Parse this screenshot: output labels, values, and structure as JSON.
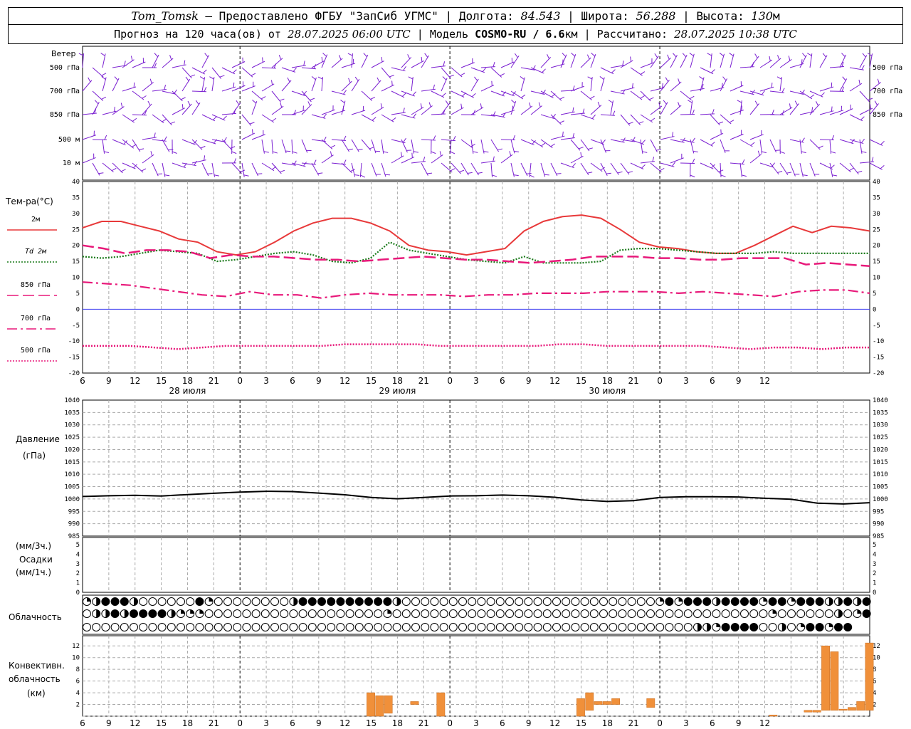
{
  "header": {
    "station": "Tom_Tomsk",
    "provider": " – Предоставлено ФГБУ \"ЗапСиб УГМС\" | Долгота: ",
    "lon": "84.543",
    "lat_label": " | Широта: ",
    "lat": "56.288",
    "alt_label": " | Высота: ",
    "alt": "130",
    "alt_unit": "м",
    "line2_a": "Прогноз на 120 часа(ов) от ",
    "run_time": "28.07.2025 06:00 UTC",
    "line2_b": " | Модель ",
    "model": "COSMO-RU / 6.6",
    "model_unit": "км",
    "line2_c": " | Рассчитано: ",
    "calc_time": "28.07.2025 10:38 UTC"
  },
  "panels": {
    "wind": {
      "title": "Ветер",
      "levels": [
        "500 гПа",
        "700 гПа",
        "850 гПа",
        "500 м",
        "10 м"
      ]
    },
    "temp": {
      "title": "Тем-ра(°С)",
      "legend": [
        {
          "label": "2м",
          "color": "#e8393a",
          "dash": "solid"
        },
        {
          "label": "Td 2м",
          "color": "#1a7a1a",
          "dash": "dotted"
        },
        {
          "label": "850 гПа",
          "color": "#e8197a",
          "dash": "long"
        },
        {
          "label": "700 гПа",
          "color": "#e8197a",
          "dash": "dashdot"
        },
        {
          "label": "500 гПа",
          "color": "#e8197a",
          "dash": "dotted"
        }
      ],
      "yticks": [
        40,
        35,
        30,
        25,
        20,
        15,
        10,
        5,
        0,
        -5,
        -10,
        -15,
        -20
      ]
    },
    "pressure": {
      "title": "Давление",
      "unit": "(гПа)",
      "yticks": [
        1040,
        1035,
        1030,
        1025,
        1020,
        1015,
        1010,
        1005,
        1000,
        995,
        990,
        985
      ]
    },
    "precip": {
      "unit_top": "(мм/3ч.)",
      "title": "Осадки",
      "unit_bottom": "(мм/1ч.)",
      "yticks": [
        5,
        4,
        3,
        2,
        1,
        0
      ]
    },
    "cloud": {
      "title": "Облачность"
    },
    "conv": {
      "title1": "Конвективн.",
      "title2": "облачность",
      "unit": "(км)",
      "yticks": [
        12,
        10,
        8,
        6,
        4,
        2
      ]
    }
  },
  "time_axis": {
    "ticks": [
      "6",
      "9",
      "12",
      "15",
      "18",
      "21",
      "0",
      "3",
      "6",
      "9",
      "12",
      "15",
      "18",
      "21",
      "0",
      "3",
      "6",
      "9",
      "12",
      "15",
      "18",
      "21",
      "0",
      "3",
      "6",
      "9",
      "12"
    ],
    "days": [
      "28 июля",
      "29 июля",
      "30 июля"
    ]
  },
  "colors": {
    "wind": "#7a1fd1",
    "t2m": "#e8393a",
    "td": "#1a7a1a",
    "upper": "#e8197a",
    "pressure": "#000000",
    "conv": "#f0903a",
    "zero": "#3a3af0"
  },
  "chart_data": {
    "type": "line",
    "x_hours": [
      0,
      3,
      6,
      9,
      12,
      15,
      18,
      21,
      24,
      27,
      30,
      33,
      36,
      39,
      42,
      45,
      48,
      51,
      54,
      57,
      60,
      63,
      66,
      69,
      72,
      75,
      78
    ],
    "series": [
      {
        "name": "2м",
        "values": [
          25.5,
          27.5,
          27.5,
          26,
          24.5,
          22,
          21,
          18,
          17,
          18,
          21,
          24.5,
          27,
          28.5,
          28.5,
          27,
          24.5,
          20,
          18.5,
          18,
          17,
          18,
          19,
          24.5,
          27.5,
          29,
          29.5,
          28.5,
          25,
          21,
          19.5,
          19,
          18,
          17.5,
          17.5,
          20,
          23,
          26,
          24,
          26,
          25.5,
          24.5
        ]
      },
      {
        "name": "Td 2м",
        "values": [
          16.5,
          16,
          16.5,
          17.5,
          18.5,
          18,
          17.5,
          15,
          15.5,
          16.5,
          17.5,
          18,
          17,
          15,
          14.5,
          16,
          21,
          18.5,
          17.5,
          16.5,
          15.5,
          15,
          14.5,
          16.5,
          14.5,
          14.5,
          14.5,
          15,
          18.5,
          19,
          19,
          18.5,
          18,
          17.5,
          17.5,
          17.5,
          18,
          17.5,
          17.5,
          17.5,
          17.5,
          17.5
        ]
      },
      {
        "name": "850 гПа",
        "values": [
          20,
          19,
          17.5,
          18.5,
          18.5,
          18,
          16,
          17,
          16.5,
          16.5,
          16,
          15.5,
          15.5,
          15,
          15.5,
          16,
          16.5,
          16,
          15.5,
          15.5,
          15,
          14.5,
          15,
          15.5,
          16.5,
          16.5,
          16.5,
          16,
          16,
          15.5,
          15.5,
          16,
          16,
          16,
          14,
          14.5,
          14,
          13.5
        ]
      },
      {
        "name": "700 гПа",
        "values": [
          8.5,
          8,
          7.5,
          6.5,
          5.5,
          4.5,
          4,
          5.5,
          4.5,
          4.5,
          3.5,
          4.5,
          5,
          4.5,
          4.5,
          4.5,
          4,
          4.5,
          4.5,
          5,
          5,
          5,
          5.5,
          5.5,
          5.5,
          5,
          5.5,
          5,
          4.5,
          4,
          5.5,
          6,
          6,
          5
        ]
      },
      {
        "name": "500 гПа",
        "values": [
          -11.5,
          -11.5,
          -11.5,
          -12,
          -12.5,
          -12,
          -11.5,
          -11.5,
          -11.5,
          -11.5,
          -11.5,
          -11,
          -11,
          -11,
          -11,
          -11.5,
          -11.5,
          -11.5,
          -11.5,
          -11.5,
          -11,
          -11,
          -11.5,
          -11.5,
          -11.5,
          -11.5,
          -11.5,
          -12,
          -12.5,
          -12,
          -12,
          -12.5,
          -12,
          -12
        ]
      }
    ],
    "pressure": [
      1001,
      1001.3,
      1001.5,
      1001.2,
      1001.8,
      1002.3,
      1002.8,
      1003.1,
      1003,
      1002.4,
      1001.7,
      1000.6,
      1000.1,
      1000.6,
      1001.2,
      1001.3,
      1001.6,
      1001.3,
      1000.7,
      999.6,
      999,
      999.3,
      1000.6,
      1000.9,
      1000.9,
      1000.8,
      1000.3,
      999.9,
      998.3,
      998,
      998.5
    ],
    "conv_bars": [
      {
        "hour": 33,
        "bottom": 0,
        "top": 4
      },
      {
        "hour": 34,
        "bottom": 0,
        "top": 3.5
      },
      {
        "hour": 35,
        "bottom": 0.5,
        "top": 3.5
      },
      {
        "hour": 38,
        "bottom": 2,
        "top": 2.5
      },
      {
        "hour": 41,
        "bottom": 0,
        "top": 4
      },
      {
        "hour": 57,
        "bottom": 0,
        "top": 3
      },
      {
        "hour": 58,
        "bottom": 1,
        "top": 4
      },
      {
        "hour": 59,
        "bottom": 2,
        "top": 2.5
      },
      {
        "hour": 60,
        "bottom": 2,
        "top": 2.5
      },
      {
        "hour": 61,
        "bottom": 2,
        "top": 3
      },
      {
        "hour": 65,
        "bottom": 1.5,
        "top": 3
      },
      {
        "hour": 79,
        "bottom": 0,
        "top": 0.2
      },
      {
        "hour": 83,
        "bottom": 0.7,
        "top": 1
      },
      {
        "hour": 84,
        "bottom": 0.7,
        "top": 1
      },
      {
        "hour": 85,
        "bottom": 1,
        "top": 12
      },
      {
        "hour": 86,
        "bottom": 1,
        "top": 11
      },
      {
        "hour": 87,
        "bottom": 1,
        "top": 1.2
      },
      {
        "hour": 88,
        "bottom": 1,
        "top": 1.5
      },
      {
        "hour": 89,
        "bottom": 1,
        "top": 2.5
      },
      {
        "hour": 90,
        "bottom": 1,
        "top": 12.5
      }
    ],
    "cloud_rows": [
      "qhfffhoooooofqoooooooohffffffffffhoooooooooooooooooooooooooooqfqfffhffffqffqfffhhfhf",
      "ohhfhffffhqqqoooooooooooooooooooqooooooooooooooooooooooooooooooooooooooooqoooooohoqff",
      "ooooooooooooooooooooooooooooooooooooooooooooooooooooooooooooooooohhqffffoohoqffqff"
    ]
  }
}
